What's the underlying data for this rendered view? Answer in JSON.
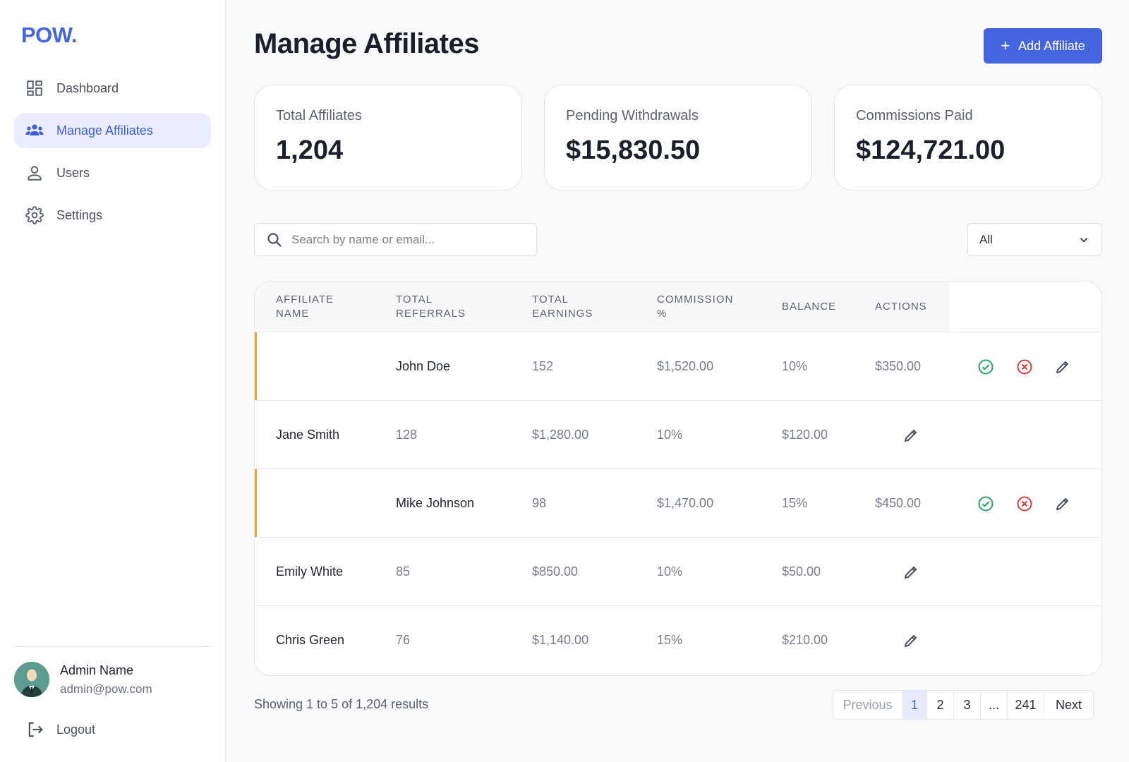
{
  "brand": {
    "logo": "POW."
  },
  "sidebar": {
    "items": [
      {
        "label": "Dashboard",
        "icon": "dashboard-icon"
      },
      {
        "label": "Manage Affiliates",
        "icon": "users-group-icon",
        "active": true
      },
      {
        "label": "Users",
        "icon": "user-icon"
      },
      {
        "label": "Settings",
        "icon": "gear-icon"
      }
    ],
    "profile": {
      "name": "Admin Name",
      "email": "admin@pow.com"
    },
    "logout_label": "Logout"
  },
  "header": {
    "title": "Manage Affiliates",
    "add_button_label": "Add Affiliate"
  },
  "stats": [
    {
      "label": "Total Affiliates",
      "value": "1,204"
    },
    {
      "label": "Pending Withdrawals",
      "value": "$15,830.50"
    },
    {
      "label": "Commissions Paid",
      "value": "$124,721.00"
    }
  ],
  "search": {
    "placeholder": "Search by name or email..."
  },
  "filter": {
    "selected": "All"
  },
  "table": {
    "headers": {
      "name": [
        "AFFILIATE",
        "NAME"
      ],
      "referrals": [
        "TOTAL",
        "REFERRALS"
      ],
      "earnings": [
        "TOTAL",
        "EARNINGS"
      ],
      "commission": [
        "COMMISSION",
        "%"
      ],
      "balance": [
        "BALANCE"
      ],
      "actions": [
        "ACTIONS"
      ]
    },
    "rows": [
      {
        "name": "John Doe",
        "referrals": "152",
        "earnings": "$1,520.00",
        "commission": "10%",
        "balance": "$350.00",
        "pending": true
      },
      {
        "name": "Jane Smith",
        "referrals": "128",
        "earnings": "$1,280.00",
        "commission": "10%",
        "balance": "$120.00",
        "pending": false
      },
      {
        "name": "Mike Johnson",
        "referrals": "98",
        "earnings": "$1,470.00",
        "commission": "15%",
        "balance": "$450.00",
        "pending": true
      },
      {
        "name": "Emily White",
        "referrals": "85",
        "earnings": "$850.00",
        "commission": "10%",
        "balance": "$50.00",
        "pending": false
      },
      {
        "name": "Chris Green",
        "referrals": "76",
        "earnings": "$1,140.00",
        "commission": "15%",
        "balance": "$210.00",
        "pending": false
      }
    ]
  },
  "pagination": {
    "summary": "Showing 1 to 5 of 1,204 results",
    "previous": "Previous",
    "pages": [
      "1",
      "2",
      "3",
      "...",
      "241"
    ],
    "next": "Next"
  },
  "colors": {
    "accent": "#4565e0",
    "pending_marker": "#f0a132",
    "approve": "#22a860",
    "reject": "#e03a3a"
  }
}
